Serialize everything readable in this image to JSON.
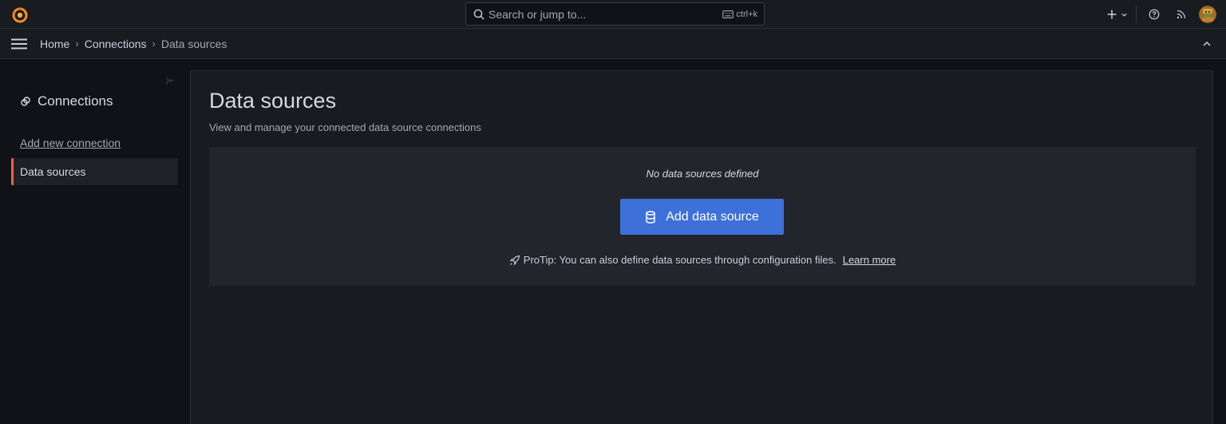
{
  "topbar": {
    "search": {
      "placeholder": "Search or jump to...",
      "shortcut": "ctrl+k"
    },
    "icons": [
      "grafana-logo-icon",
      "plus-icon",
      "chevron-down-icon",
      "help-icon",
      "news-rss-icon",
      "user-avatar"
    ]
  },
  "breadcrumbs": [
    "Home",
    "Connections",
    "Data sources"
  ],
  "sidebar": {
    "title": "Connections",
    "items": [
      {
        "label": "Add new connection",
        "active": false
      },
      {
        "label": "Data sources",
        "active": true
      }
    ]
  },
  "main": {
    "title": "Data sources",
    "subtitle": "View and manage your connected data source connections",
    "empty_text": "No data sources defined",
    "add_button_label": "Add data source",
    "protip_text": "ProTip: You can also define data sources through configuration files.",
    "learn_more": "Learn more"
  },
  "colors": {
    "accent": "#3d71d9",
    "active_indicator": "#f55f3e",
    "background": "#111217",
    "panel": "#181b1f"
  }
}
